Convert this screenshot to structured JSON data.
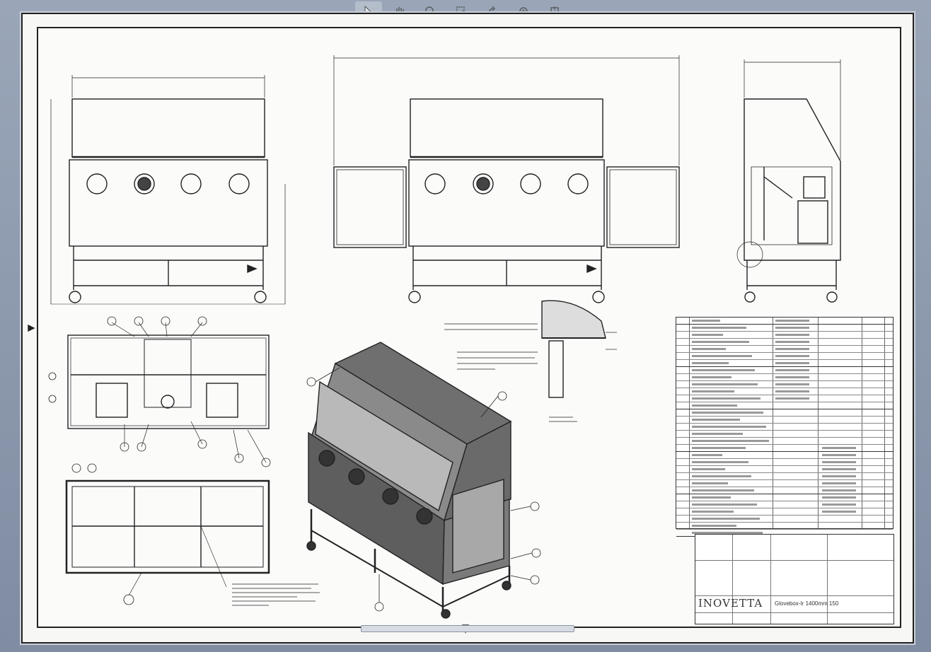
{
  "toolbar": {
    "tools": [
      {
        "name": "select-tool",
        "icon": "cursor-icon",
        "active": true
      },
      {
        "name": "pan-tool",
        "icon": "hand-icon",
        "active": false
      },
      {
        "name": "zoom-tool",
        "icon": "magnifier-icon",
        "active": false
      },
      {
        "name": "zoom-window-tool",
        "icon": "zoom-window-icon",
        "active": false
      },
      {
        "name": "rotate-tool",
        "icon": "rotate-icon",
        "active": false
      },
      {
        "name": "measure-tool",
        "icon": "measure-icon",
        "active": false
      },
      {
        "name": "section-tool",
        "icon": "section-icon",
        "active": false
      }
    ]
  },
  "title_block": {
    "company": "INOVETTA",
    "drawing_title": "Glovebox-Ir  1400mm 150"
  },
  "colors": {
    "sheet_background": "#f7f7f5",
    "line_color": "#222222",
    "app_background": "#8c98ad"
  }
}
